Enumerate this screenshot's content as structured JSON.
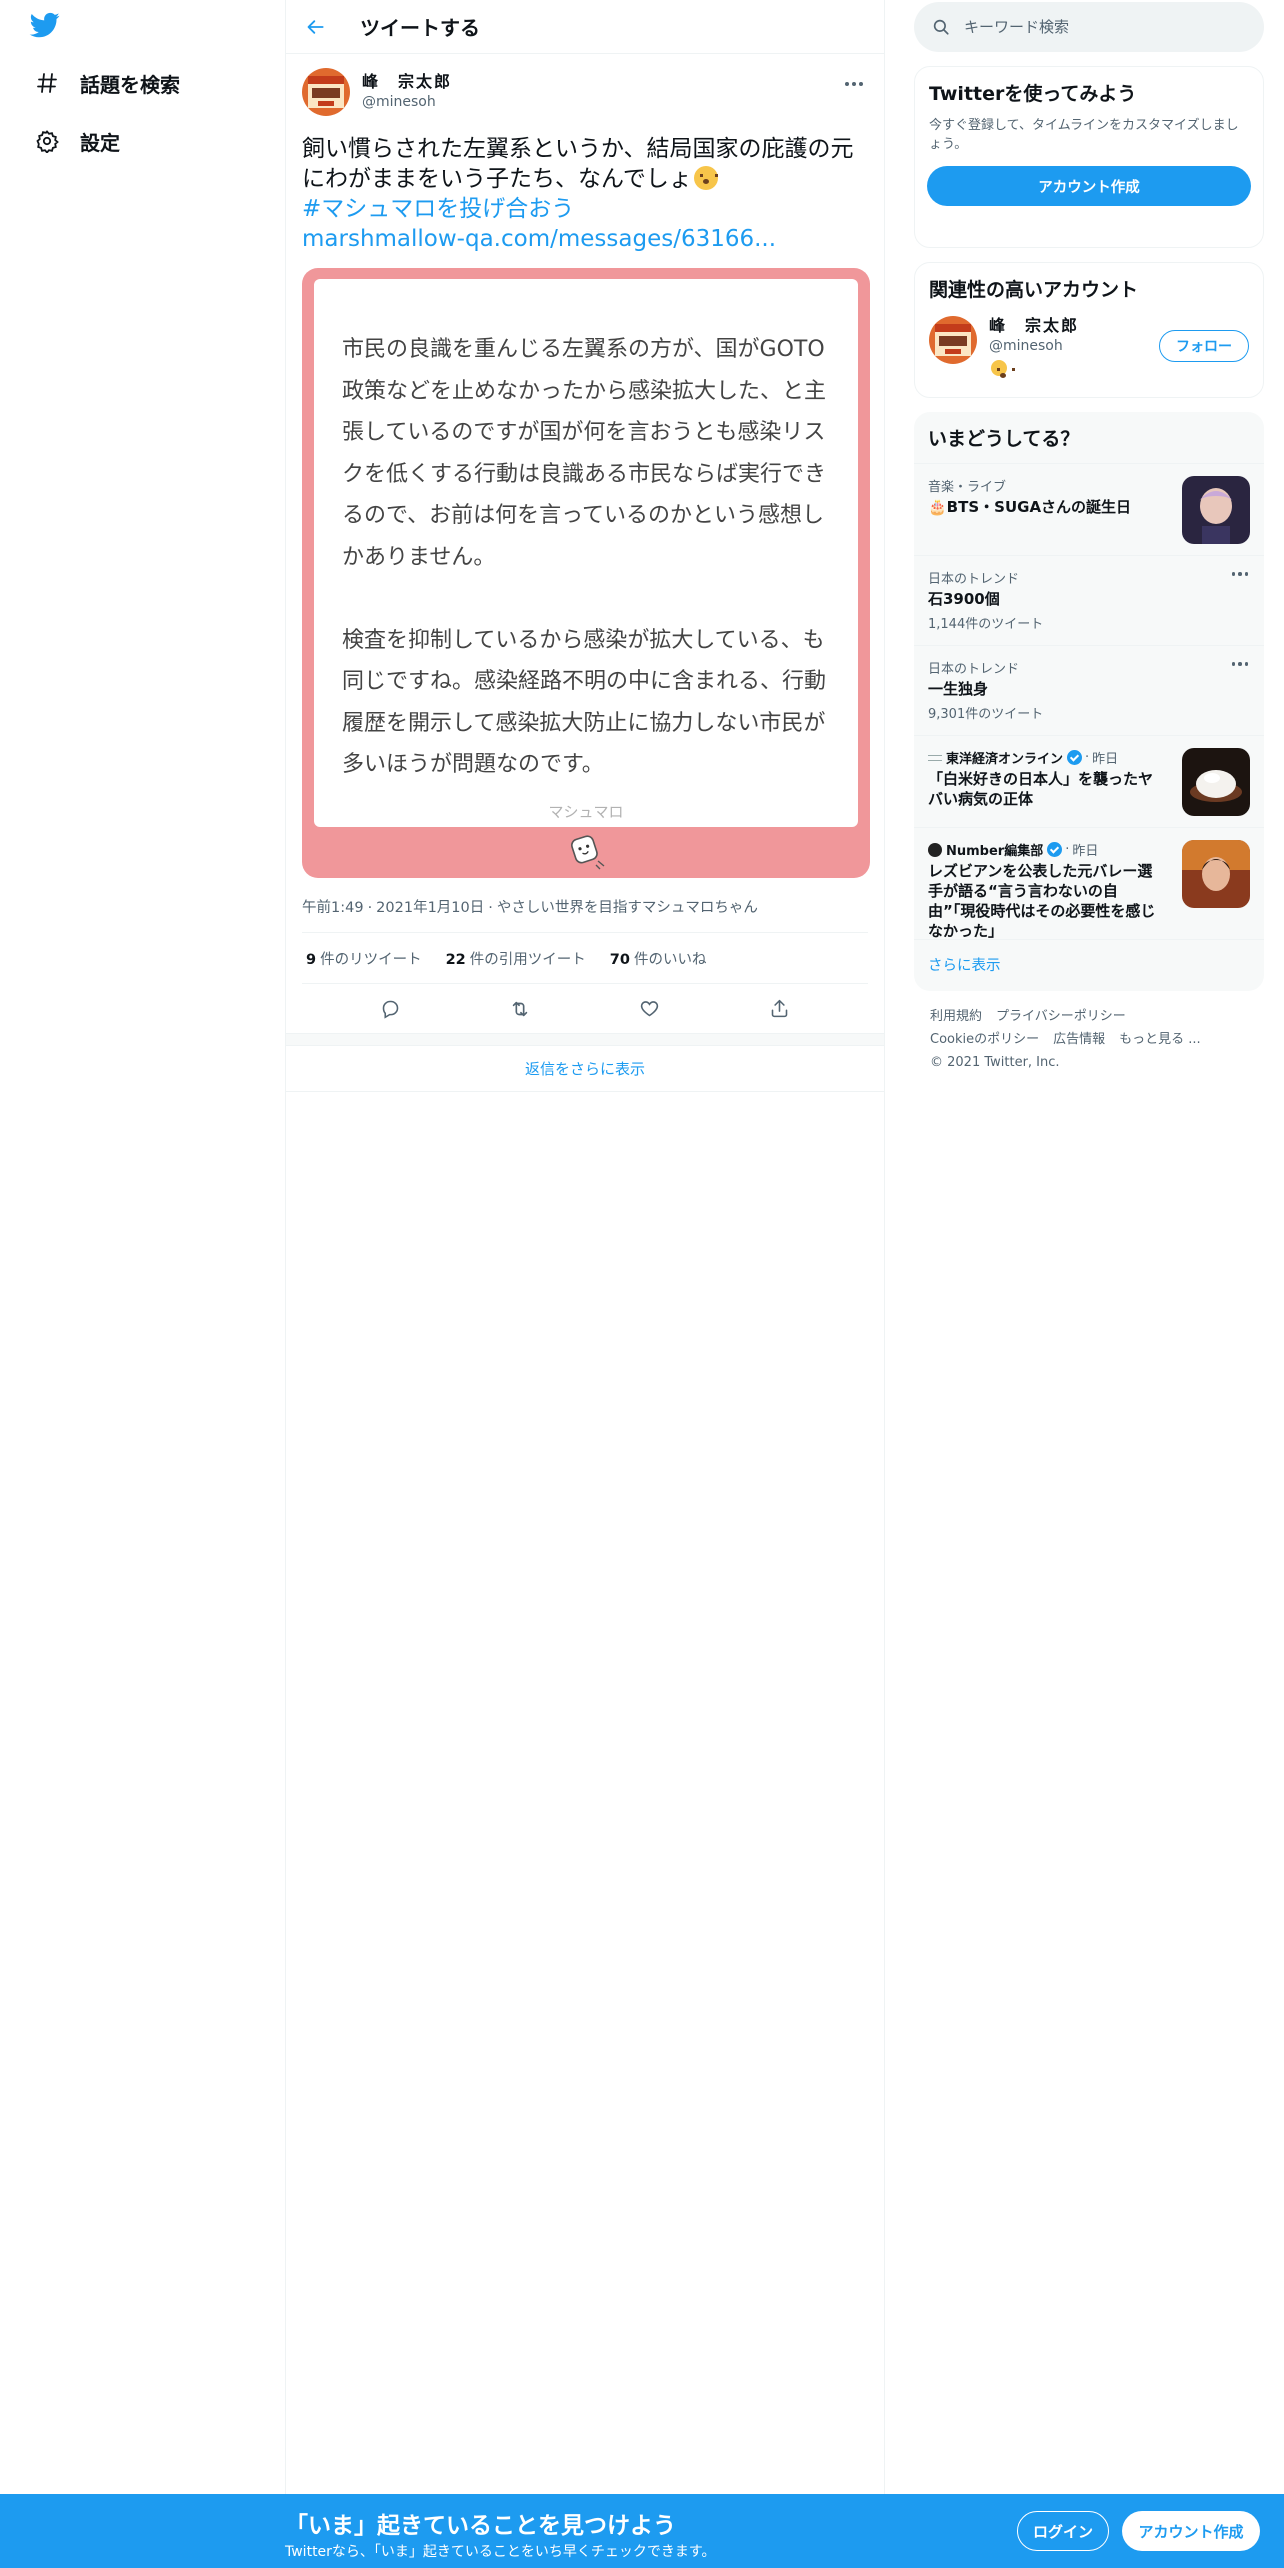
{
  "nav": {
    "items": [
      {
        "icon": "hashtag-icon",
        "label": "話題を検索"
      },
      {
        "icon": "gear-icon",
        "label": "設定"
      }
    ]
  },
  "header": {
    "title": "ツイートする"
  },
  "tweet": {
    "author_name": "峰　宗太郎",
    "author_handle": "@minesoh",
    "text": "飼い慣らされた左翼系というか、結局国家の庇護の元にわがままをいう子たち、なんでしょ",
    "hashtag": "#マシュマロを投げ合おう",
    "link": "marshmallow-qa.com/messages/63166...",
    "card": {
      "question": "市民の良識を重んじる左翼系の方が、国がGOTO政策などを止めなかったから感染拡大した、と主張しているのですが国が何を言おうとも感染リスクを低くする行動は良識ある市民ならば実行できるので、お前は何を言っているのかという感想しかありません。\n\n検査を抑制しているから感染が拡大している、も同じですね。感染経路不明の中に含まれる、行動履歴を開示して感染拡大防止に協力しない市民が多いほうが問題なのです。",
      "brand": "マシュマロ",
      "bg_color": "#f0979a"
    },
    "time": "午前1:49",
    "date": "2021年1月10日",
    "source": "やさしい世界を目指すマシュマロちゃん",
    "retweets": "9",
    "retweets_label": "件のリツイート",
    "quotes": "22",
    "quotes_label": "件の引用ツイート",
    "likes": "70",
    "likes_label": "件のいいね",
    "show_more_replies": "返信をさらに表示"
  },
  "search": {
    "placeholder": "キーワード検索"
  },
  "signup_panel": {
    "title": "Twitterを使ってみよう",
    "desc": "今すぐ登録して、タイムラインをカスタマイズしましょう。",
    "button": "アカウント作成"
  },
  "related": {
    "title": "関連性の高いアカウント",
    "name": "峰　宗太郎",
    "handle": "@minesoh",
    "follow": "フォロー"
  },
  "trends": {
    "title": "いまどうしてる？",
    "items": [
      {
        "ctx": "音楽・ライブ",
        "title": "🎂BTS・SUGAさんの誕生日"
      },
      {
        "ctx": "日本のトレンド",
        "title": "石3900個",
        "count": "1,144件のツイート"
      },
      {
        "ctx": "日本のトレンド",
        "title": "一生独身",
        "count": "9,301件のツイート"
      },
      {
        "source": "東洋経済オンライン",
        "time": "昨日",
        "title": "「白米好きの日本人」を襲ったヤバい病気の正体"
      },
      {
        "source": "Number編集部",
        "time": "昨日",
        "title": "レズビアンを公表した元バレー選手が語る“言う言わないの自由”「現役時代はその必要性を感じなかった」"
      }
    ],
    "show_more": "さらに表示"
  },
  "footer": {
    "links": [
      "利用規約",
      "プライバシーポリシー",
      "Cookieのポリシー",
      "広告情報",
      "もっと見る ..."
    ],
    "copyright": "© 2021 Twitter, Inc."
  },
  "bottom_bar": {
    "title": "「いま」起きていることを見つけよう",
    "subtitle": "Twitterなら、「いま」起きていることをいち早くチェックできます。",
    "login": "ログイン",
    "signup": "アカウント作成"
  },
  "colors": {
    "accent": "#1d9bf0",
    "card": "#f0979a",
    "secondary_text": "#536471"
  }
}
